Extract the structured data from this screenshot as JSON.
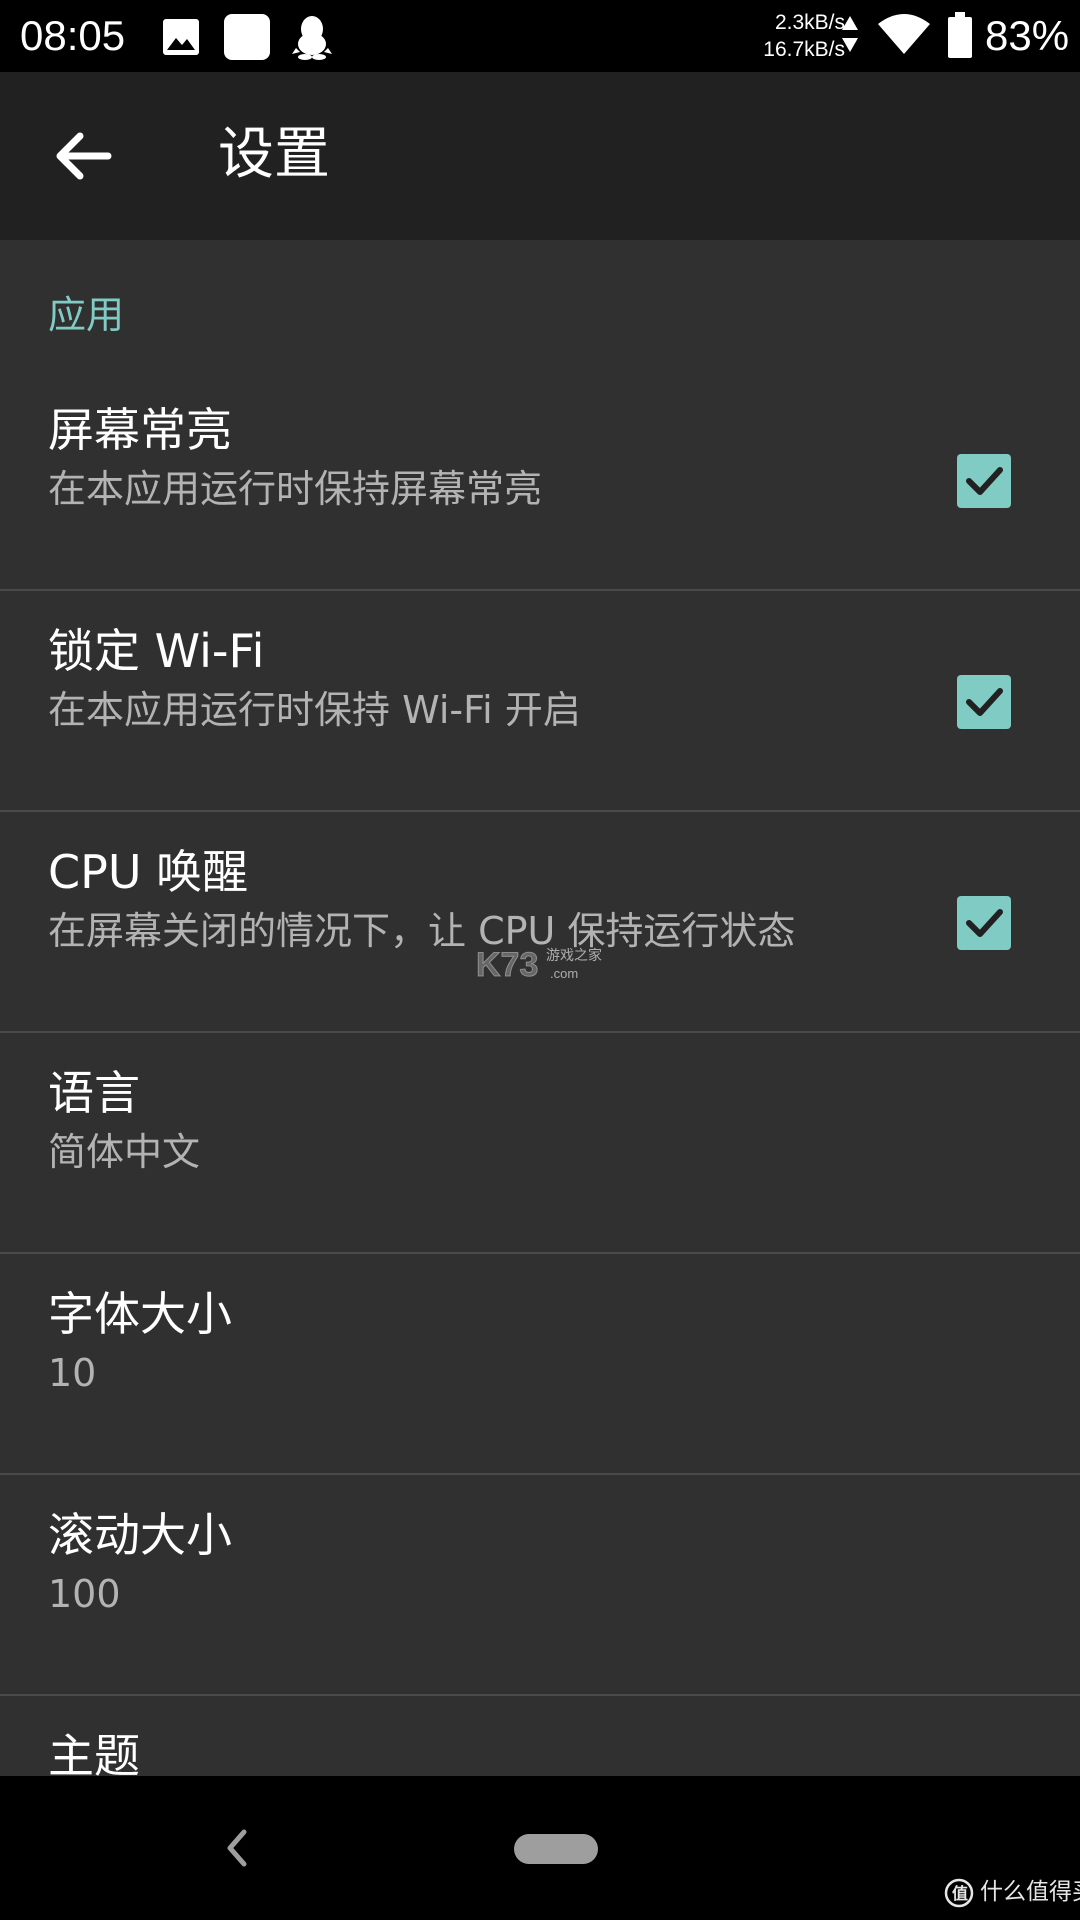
{
  "status_bar": {
    "time": "08:05",
    "upload_speed": "2.3kB/s",
    "download_speed": "16.7kB/s",
    "battery_percent": "83%",
    "icons": [
      "gallery-icon",
      "app-notification-icon",
      "qq-penguin-icon",
      "wifi-icon",
      "battery-icon"
    ]
  },
  "toolbar": {
    "title": "设置",
    "back_icon": "arrow-left-icon"
  },
  "settings": {
    "category": "应用",
    "items": [
      {
        "title": "屏幕常亮",
        "summary": "在本应用运行时保持屏幕常亮",
        "checked": true
      },
      {
        "title": "锁定 Wi-Fi",
        "summary": "在本应用运行时保持 Wi-Fi 开启",
        "checked": true
      },
      {
        "title": "CPU 唤醒",
        "summary": "在屏幕关闭的情况下，让 CPU 保持运行状态",
        "checked": true
      },
      {
        "title": "语言",
        "summary": "简体中文"
      },
      {
        "title": "字体大小",
        "summary": "10"
      },
      {
        "title": "滚动大小",
        "summary": "100"
      },
      {
        "title": "主题"
      }
    ]
  },
  "watermark": {
    "text": "K73",
    "subtext": "游戏之家",
    "domain": ".com"
  },
  "corner_logo": {
    "text": "什么值得买"
  },
  "colors": {
    "accent": "#80cbc4",
    "background": "#303030",
    "toolbar": "#212121",
    "divider": "#4a4a4a",
    "summary_text": "#b3b3b3"
  }
}
